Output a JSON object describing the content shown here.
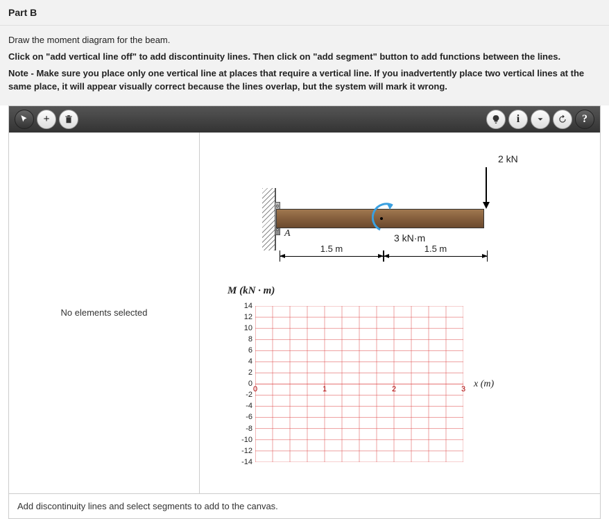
{
  "header": {
    "part_label": "Part B"
  },
  "instructions": {
    "line1": "Draw the moment diagram for the beam.",
    "line2": "Click on \"add vertical line off\" to add discontinuity lines. Then click on \"add segment\" button to add functions between the lines.",
    "line3": "Note - Make sure you place only one vertical line at places that require a vertical line. If you inadvertently place two vertical lines at the same place, it will appear visually correct because the lines overlap, but the system will mark it wrong."
  },
  "sidebar": {
    "status": "No elements selected"
  },
  "beam": {
    "point_a": "A",
    "force_label": "2 kN",
    "moment_label": "3 kN·m",
    "dim1": "1.5 m",
    "dim2": "1.5 m"
  },
  "chart_data": {
    "type": "line",
    "title": "M (kN · m)",
    "xlabel": "x (m)",
    "ylabel": "",
    "x_ticks": [
      0,
      1,
      2,
      3
    ],
    "y_ticks": [
      14,
      12,
      10,
      8,
      6,
      4,
      2,
      0,
      -2,
      -4,
      -6,
      -8,
      -10,
      -12,
      -14
    ],
    "xlim": [
      0,
      3
    ],
    "ylim": [
      -14,
      14
    ],
    "x_tick_labels_visible": [
      "0",
      "1",
      "2",
      "3"
    ],
    "series": []
  },
  "status": {
    "hint": "Add discontinuity lines and select segments to add to the canvas."
  },
  "toolbar": {
    "icons_left": [
      "cursor",
      "add",
      "trash"
    ],
    "icons_right": [
      "bulb",
      "info",
      "dropdown",
      "reset",
      "help"
    ]
  }
}
